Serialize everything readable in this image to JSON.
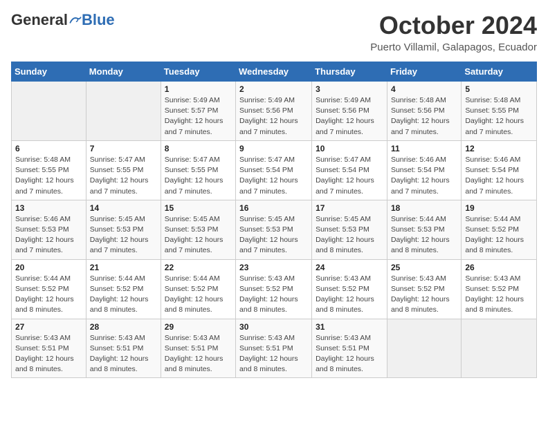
{
  "header": {
    "logo_general": "General",
    "logo_blue": "Blue",
    "month": "October 2024",
    "location": "Puerto Villamil, Galapagos, Ecuador"
  },
  "days_of_week": [
    "Sunday",
    "Monday",
    "Tuesday",
    "Wednesday",
    "Thursday",
    "Friday",
    "Saturday"
  ],
  "weeks": [
    [
      {
        "day": "",
        "detail": ""
      },
      {
        "day": "",
        "detail": ""
      },
      {
        "day": "1",
        "detail": "Sunrise: 5:49 AM\nSunset: 5:57 PM\nDaylight: 12 hours and 7 minutes."
      },
      {
        "day": "2",
        "detail": "Sunrise: 5:49 AM\nSunset: 5:56 PM\nDaylight: 12 hours and 7 minutes."
      },
      {
        "day": "3",
        "detail": "Sunrise: 5:49 AM\nSunset: 5:56 PM\nDaylight: 12 hours and 7 minutes."
      },
      {
        "day": "4",
        "detail": "Sunrise: 5:48 AM\nSunset: 5:56 PM\nDaylight: 12 hours and 7 minutes."
      },
      {
        "day": "5",
        "detail": "Sunrise: 5:48 AM\nSunset: 5:55 PM\nDaylight: 12 hours and 7 minutes."
      }
    ],
    [
      {
        "day": "6",
        "detail": "Sunrise: 5:48 AM\nSunset: 5:55 PM\nDaylight: 12 hours and 7 minutes."
      },
      {
        "day": "7",
        "detail": "Sunrise: 5:47 AM\nSunset: 5:55 PM\nDaylight: 12 hours and 7 minutes."
      },
      {
        "day": "8",
        "detail": "Sunrise: 5:47 AM\nSunset: 5:55 PM\nDaylight: 12 hours and 7 minutes."
      },
      {
        "day": "9",
        "detail": "Sunrise: 5:47 AM\nSunset: 5:54 PM\nDaylight: 12 hours and 7 minutes."
      },
      {
        "day": "10",
        "detail": "Sunrise: 5:47 AM\nSunset: 5:54 PM\nDaylight: 12 hours and 7 minutes."
      },
      {
        "day": "11",
        "detail": "Sunrise: 5:46 AM\nSunset: 5:54 PM\nDaylight: 12 hours and 7 minutes."
      },
      {
        "day": "12",
        "detail": "Sunrise: 5:46 AM\nSunset: 5:54 PM\nDaylight: 12 hours and 7 minutes."
      }
    ],
    [
      {
        "day": "13",
        "detail": "Sunrise: 5:46 AM\nSunset: 5:53 PM\nDaylight: 12 hours and 7 minutes."
      },
      {
        "day": "14",
        "detail": "Sunrise: 5:45 AM\nSunset: 5:53 PM\nDaylight: 12 hours and 7 minutes."
      },
      {
        "day": "15",
        "detail": "Sunrise: 5:45 AM\nSunset: 5:53 PM\nDaylight: 12 hours and 7 minutes."
      },
      {
        "day": "16",
        "detail": "Sunrise: 5:45 AM\nSunset: 5:53 PM\nDaylight: 12 hours and 7 minutes."
      },
      {
        "day": "17",
        "detail": "Sunrise: 5:45 AM\nSunset: 5:53 PM\nDaylight: 12 hours and 8 minutes."
      },
      {
        "day": "18",
        "detail": "Sunrise: 5:44 AM\nSunset: 5:53 PM\nDaylight: 12 hours and 8 minutes."
      },
      {
        "day": "19",
        "detail": "Sunrise: 5:44 AM\nSunset: 5:52 PM\nDaylight: 12 hours and 8 minutes."
      }
    ],
    [
      {
        "day": "20",
        "detail": "Sunrise: 5:44 AM\nSunset: 5:52 PM\nDaylight: 12 hours and 8 minutes."
      },
      {
        "day": "21",
        "detail": "Sunrise: 5:44 AM\nSunset: 5:52 PM\nDaylight: 12 hours and 8 minutes."
      },
      {
        "day": "22",
        "detail": "Sunrise: 5:44 AM\nSunset: 5:52 PM\nDaylight: 12 hours and 8 minutes."
      },
      {
        "day": "23",
        "detail": "Sunrise: 5:43 AM\nSunset: 5:52 PM\nDaylight: 12 hours and 8 minutes."
      },
      {
        "day": "24",
        "detail": "Sunrise: 5:43 AM\nSunset: 5:52 PM\nDaylight: 12 hours and 8 minutes."
      },
      {
        "day": "25",
        "detail": "Sunrise: 5:43 AM\nSunset: 5:52 PM\nDaylight: 12 hours and 8 minutes."
      },
      {
        "day": "26",
        "detail": "Sunrise: 5:43 AM\nSunset: 5:52 PM\nDaylight: 12 hours and 8 minutes."
      }
    ],
    [
      {
        "day": "27",
        "detail": "Sunrise: 5:43 AM\nSunset: 5:51 PM\nDaylight: 12 hours and 8 minutes."
      },
      {
        "day": "28",
        "detail": "Sunrise: 5:43 AM\nSunset: 5:51 PM\nDaylight: 12 hours and 8 minutes."
      },
      {
        "day": "29",
        "detail": "Sunrise: 5:43 AM\nSunset: 5:51 PM\nDaylight: 12 hours and 8 minutes."
      },
      {
        "day": "30",
        "detail": "Sunrise: 5:43 AM\nSunset: 5:51 PM\nDaylight: 12 hours and 8 minutes."
      },
      {
        "day": "31",
        "detail": "Sunrise: 5:43 AM\nSunset: 5:51 PM\nDaylight: 12 hours and 8 minutes."
      },
      {
        "day": "",
        "detail": ""
      },
      {
        "day": "",
        "detail": ""
      }
    ]
  ]
}
